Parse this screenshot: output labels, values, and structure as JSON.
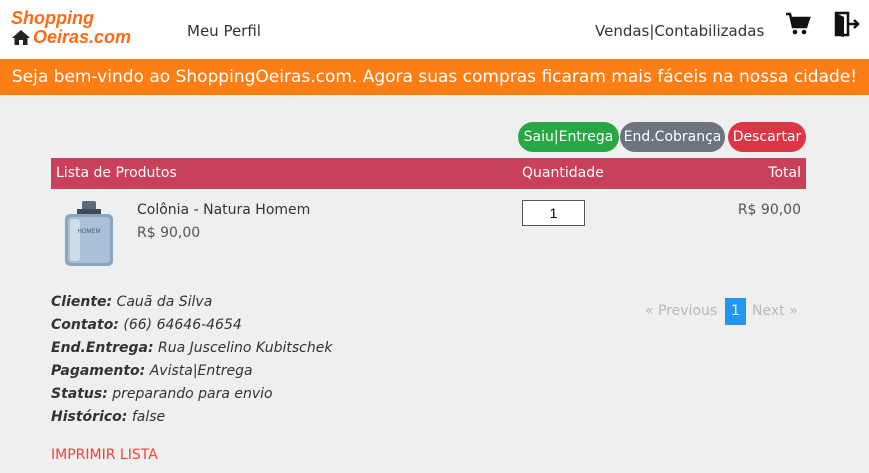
{
  "navbar": {
    "logo_line1": "Shopping",
    "logo_line2": "Oeiras.com",
    "links": {
      "perfil": "Meu Perfil",
      "vendas": "Vendas|Contabilizadas"
    },
    "icons": [
      "home-icon",
      "cart-icon",
      "logout-icon"
    ]
  },
  "banner": {
    "text": "Seja bem-vindo ao ShoppingOeiras.com. Agora suas compras ficaram mais fáceis na nossa cidade!"
  },
  "actions": {
    "saiu": "Saiu|Entrega",
    "end_cobranca": "End.Cobrança",
    "descartar": "Descartar"
  },
  "table": {
    "headers": {
      "produtos": "Lista de Produtos",
      "quantidade": "Quantidade",
      "total": "Total"
    },
    "rows": [
      {
        "name": "Colônia - Natura Homem",
        "price": "R$ 90,00",
        "quantity": "1",
        "total": "R$ 90,00"
      }
    ]
  },
  "order": {
    "cliente_label": "Cliente:",
    "cliente": "Cauã da Silva",
    "contato_label": "Contato:",
    "contato": "(66) 64646-4654",
    "entrega_label": "End.Entrega:",
    "entrega": "Rua Juscelino Kubitschek",
    "pagamento_label": "Pagamento:",
    "pagamento": "Avista|Entrega",
    "status_label": "Status:",
    "status": "preparando para envio",
    "historico_label": "Histórico:",
    "historico": "false"
  },
  "pagination": {
    "prev": "«  Previous",
    "page": "1",
    "next": "Next  »"
  },
  "print": {
    "label": "IMPRIMIR LISTA"
  },
  "colors": {
    "accent": "#fd7e14",
    "table_header": "#c9405a",
    "success": "#28a745",
    "secondary": "#6c757d",
    "danger": "#dc3545",
    "page_active": "#2196f3",
    "print": "#f44336"
  }
}
